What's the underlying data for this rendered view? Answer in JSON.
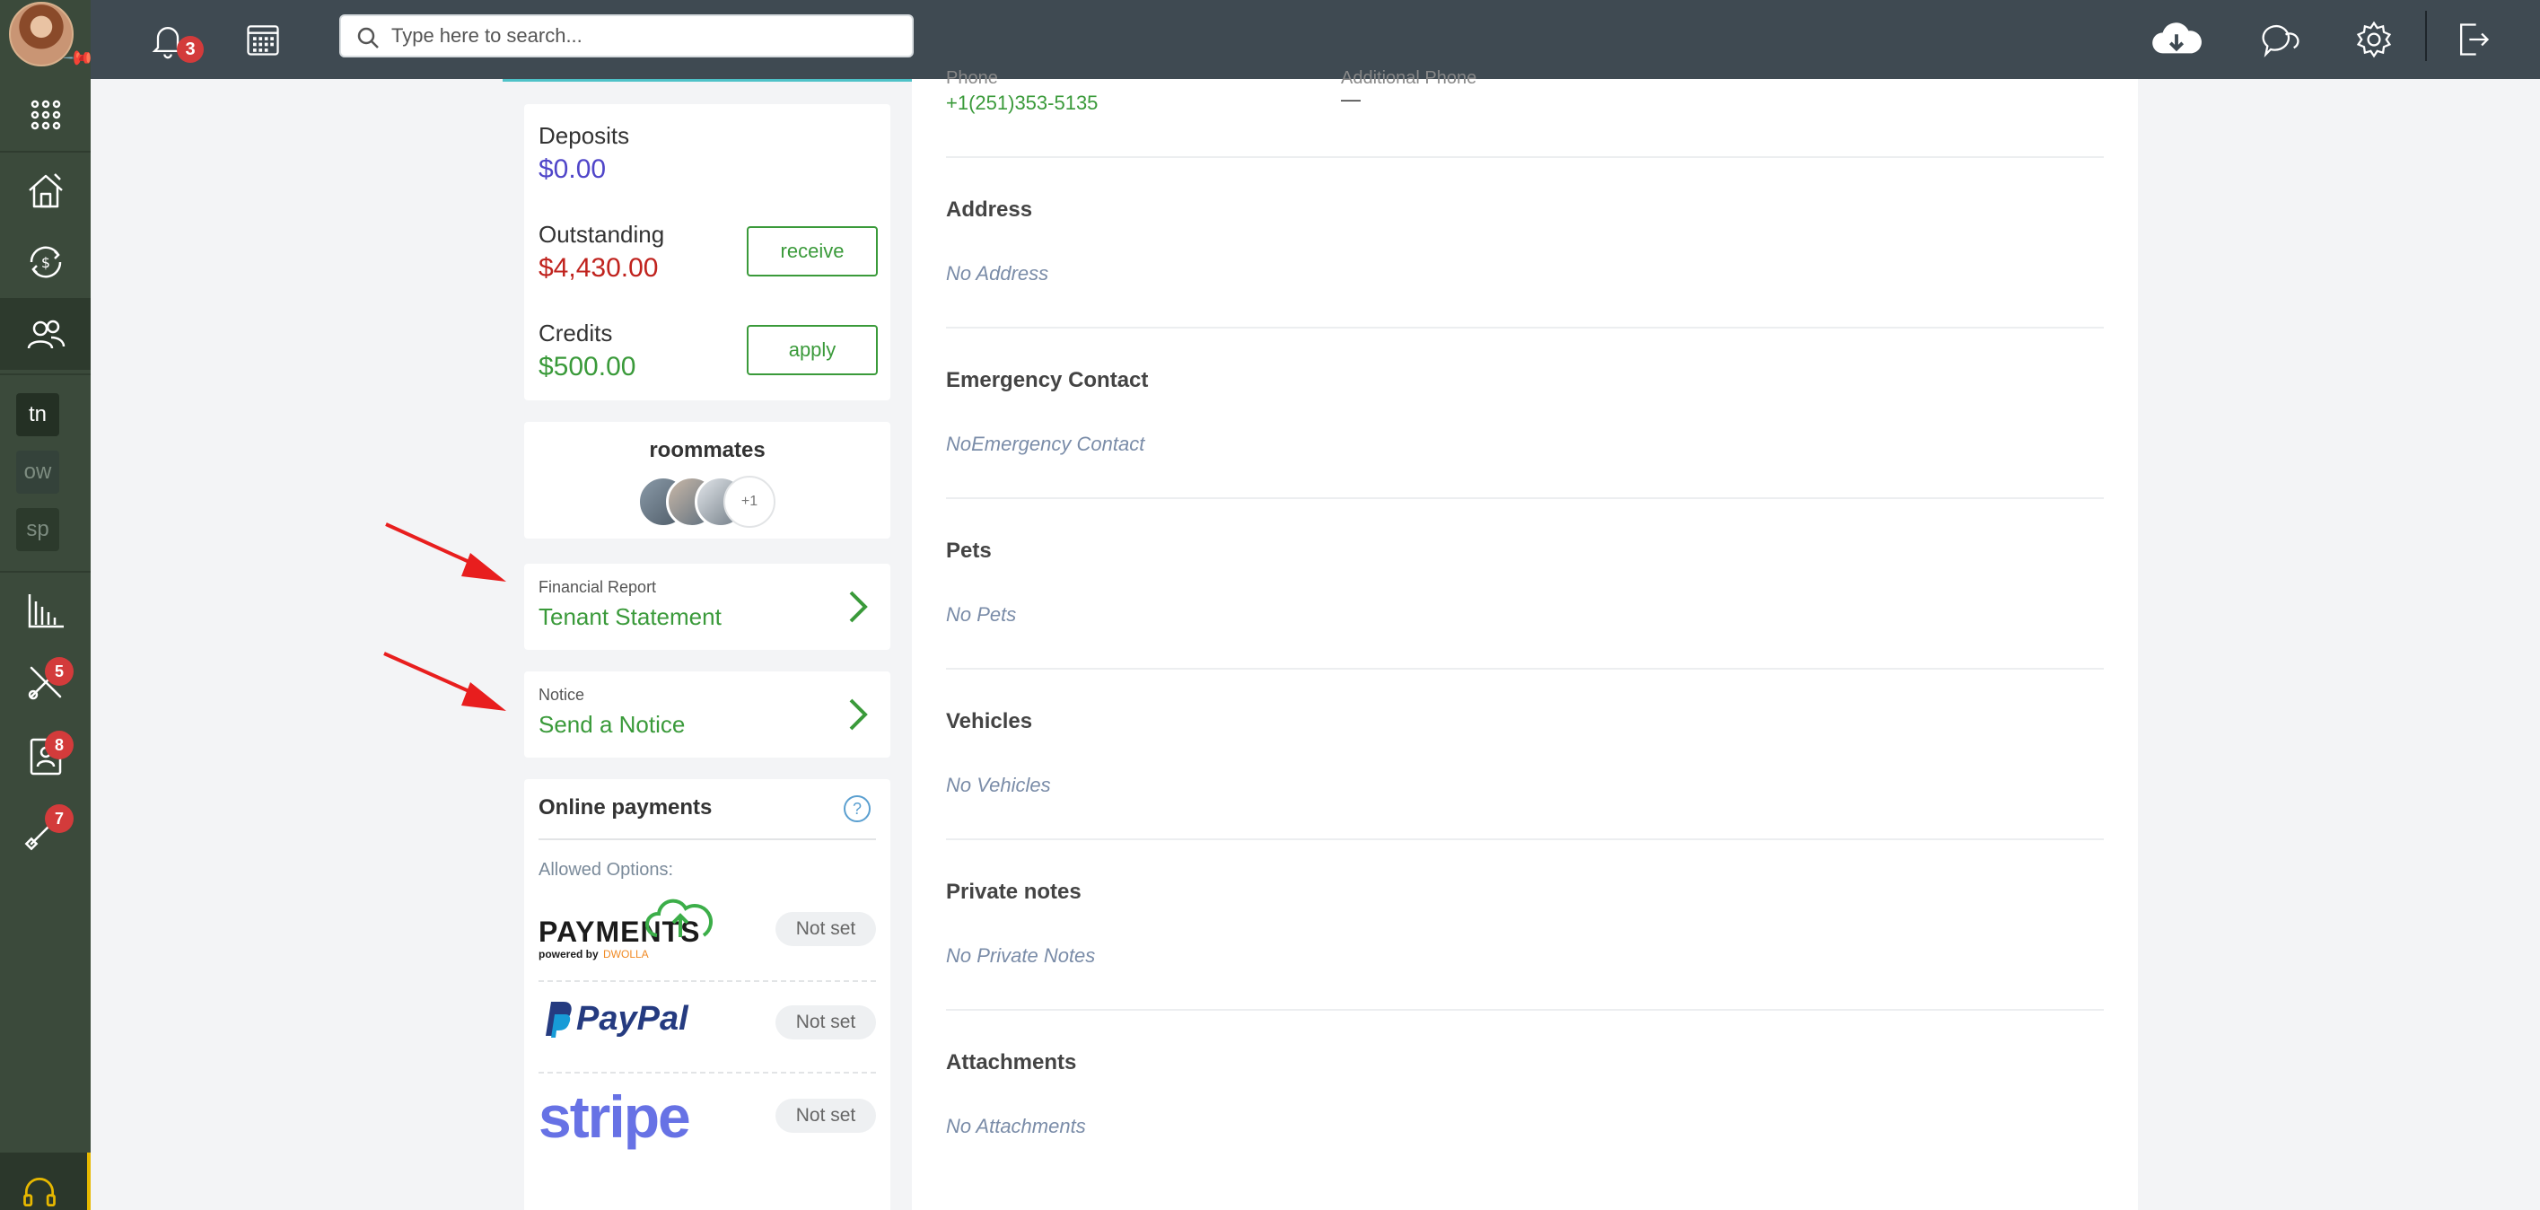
{
  "topbar": {
    "notification_count": "3",
    "search_placeholder": "Type here to search..."
  },
  "sidebar": {
    "abbreviations": [
      "tn",
      "ow",
      "sp"
    ],
    "badges": {
      "maintenance": "5",
      "contacts": "8",
      "tools": "7"
    }
  },
  "balances": {
    "deposits_label": "Deposits",
    "deposits_value": "$0.00",
    "outstanding_label": "Outstanding",
    "outstanding_value": "$4,430.00",
    "receive_label": "receive",
    "credits_label": "Credits",
    "credits_value": "$500.00",
    "apply_label": "apply"
  },
  "roommates": {
    "title": "roommates",
    "more": "+1"
  },
  "financial_report": {
    "category": "Financial Report",
    "title": "Tenant Statement"
  },
  "notice": {
    "category": "Notice",
    "title": "Send a Notice"
  },
  "online_payments": {
    "title": "Online payments",
    "help": "?",
    "allowed_label": "Allowed Options:",
    "providers": [
      {
        "name": "PAYMENTS",
        "powered": "powered by",
        "powered_brand": "DWOLLA",
        "status": "Not set"
      },
      {
        "name": "PayPal",
        "status": "Not set"
      },
      {
        "name": "stripe",
        "status": "Not set"
      }
    ]
  },
  "details": {
    "phone_label": "Phone",
    "phone_value": "+1(251)353-5135",
    "additional_phone_label": "Additional Phone",
    "additional_phone_value": "—",
    "sections": [
      {
        "title": "Address",
        "empty": "No Address"
      },
      {
        "title": "Emergency Contact",
        "empty": "NoEmergency Contact"
      },
      {
        "title": "Pets",
        "empty": "No Pets"
      },
      {
        "title": "Vehicles",
        "empty": "No Vehicles"
      },
      {
        "title": "Private notes",
        "empty": "No Private Notes"
      },
      {
        "title": "Attachments",
        "empty": "No Attachments"
      }
    ]
  },
  "colors": {
    "sidebar": "#3b4a3b",
    "topbar": "#3f4a52",
    "accent_green": "#3a9a3a",
    "deposit_blue": "#5046c9",
    "outstanding_red": "#c0231e",
    "badge_red": "#d33b3b"
  }
}
